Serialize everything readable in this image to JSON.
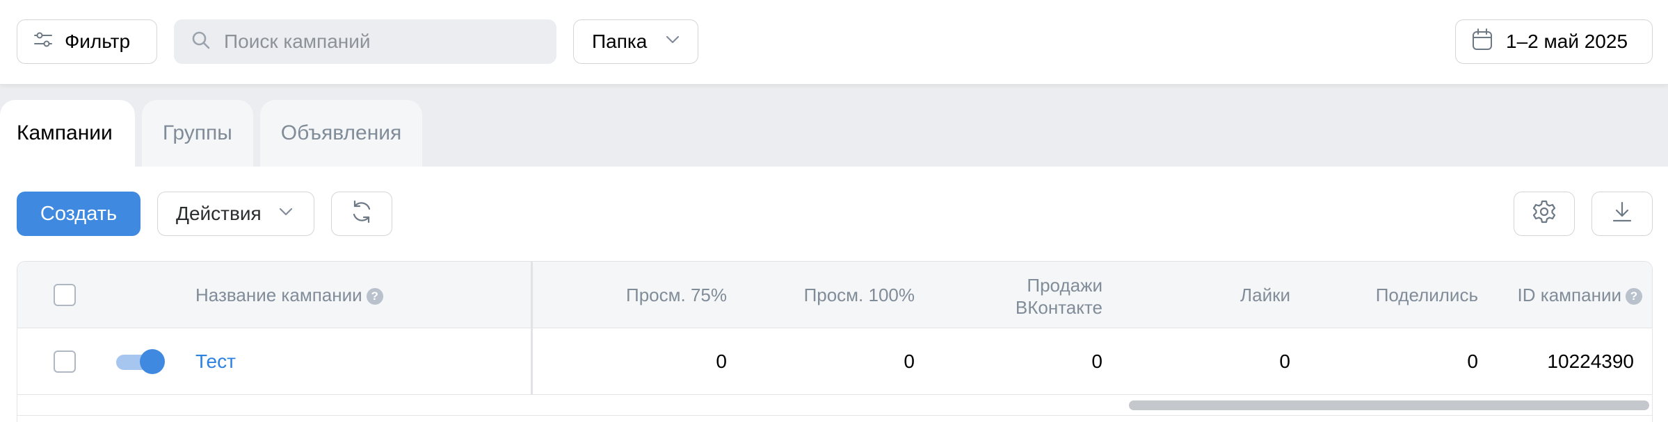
{
  "topbar": {
    "filter_label": "Фильтр",
    "search_placeholder": "Поиск кампаний",
    "search_value": "",
    "folder_label": "Папка",
    "date_range": "1–2 май 2025"
  },
  "tabs": [
    {
      "label": "Кампании",
      "active": true
    },
    {
      "label": "Группы",
      "active": false
    },
    {
      "label": "Объявления",
      "active": false
    }
  ],
  "toolbar": {
    "create_label": "Создать",
    "actions_label": "Действия"
  },
  "icons": {
    "filter": "sliders-icon",
    "search": "search-icon",
    "folder_dropdown": "chevron-down-icon",
    "calendar": "calendar-icon",
    "refresh": "refresh-icon",
    "settings": "gear-icon",
    "download": "download-icon",
    "help": "question-icon"
  },
  "colors": {
    "accent": "#3f8ae0",
    "link": "#2d81e0",
    "header_bg": "#f5f6f8",
    "page_bg": "#ebedf0",
    "muted_text": "#818c99"
  },
  "table": {
    "columns": {
      "name": "Название кампании",
      "views75": "Просм. 75%",
      "views100": "Просм. 100%",
      "sales_vk_line1": "Продажи",
      "sales_vk_line2": "ВКонтакте",
      "likes": "Лайки",
      "shares": "Поделились",
      "campaign_id": "ID кампании"
    },
    "rows": [
      {
        "checked": false,
        "enabled": true,
        "name": "Тест",
        "views75": "0",
        "views100": "0",
        "sales_vk": "0",
        "likes": "0",
        "shares": "0",
        "campaign_id": "10224390"
      }
    ]
  }
}
